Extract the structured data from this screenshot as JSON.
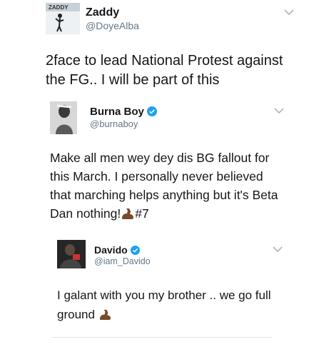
{
  "tweet1": {
    "name": "Zaddy",
    "handle": "@DoyeAlba",
    "text": "2face to lead National Protest against the FG.. I will be part of this",
    "avatar_icon": "profile-photo"
  },
  "tweet2": {
    "name": "Burna Boy",
    "handle": "@burnaboy",
    "verified": true,
    "text_before_emoji": "Make all men wey dey dis BG fallout for this March. I personally never believed that marching helps anything but it's Beta Dan nothing!",
    "emoji": "flexed-biceps-icon",
    "text_after_emoji": "#7",
    "avatar_icon": "profile-photo"
  },
  "tweet3": {
    "name": "Davido",
    "handle": "@iam_Davido",
    "verified": true,
    "text": "I galant with you my brother .. we go full ground",
    "emoji": "flexed-biceps-icon",
    "avatar_icon": "profile-photo"
  },
  "colors": {
    "text": "#14171a",
    "handle": "#657786",
    "verified": "#1da1f2",
    "divider": "#e1e8ed",
    "emoji": "#7a4a2a"
  }
}
